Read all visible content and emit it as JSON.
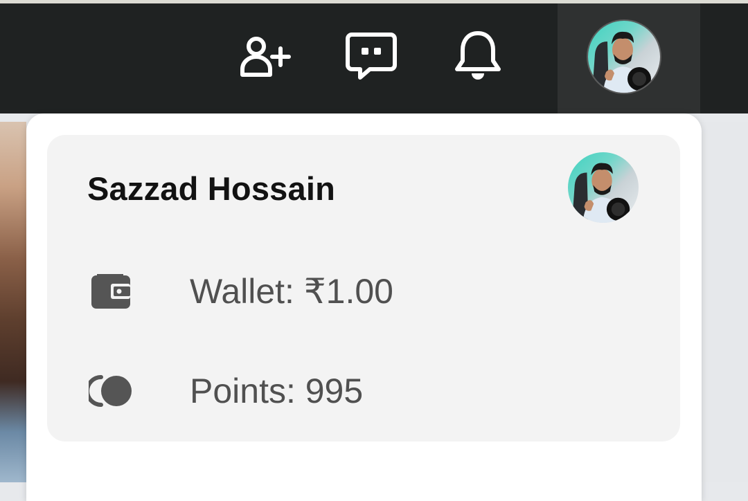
{
  "topbar": {
    "icons": [
      {
        "name": "add-friend-icon"
      },
      {
        "name": "chat-icon"
      },
      {
        "name": "bell-icon"
      }
    ],
    "avatar": {
      "name": "avatar"
    }
  },
  "menu": {
    "user_name": "Sazzad Hossain",
    "wallet": {
      "icon": "wallet-icon",
      "label": "Wallet: ₹1.00"
    },
    "points": {
      "icon": "coins-icon",
      "label": "Points: 995"
    }
  },
  "colors": {
    "topbar_bg": "#1f2222",
    "profile_slot_bg": "#2f3131",
    "card_bg": "#f3f3f3",
    "icon_gray": "#555555",
    "name_text": "#121212",
    "row_text": "#505050"
  }
}
